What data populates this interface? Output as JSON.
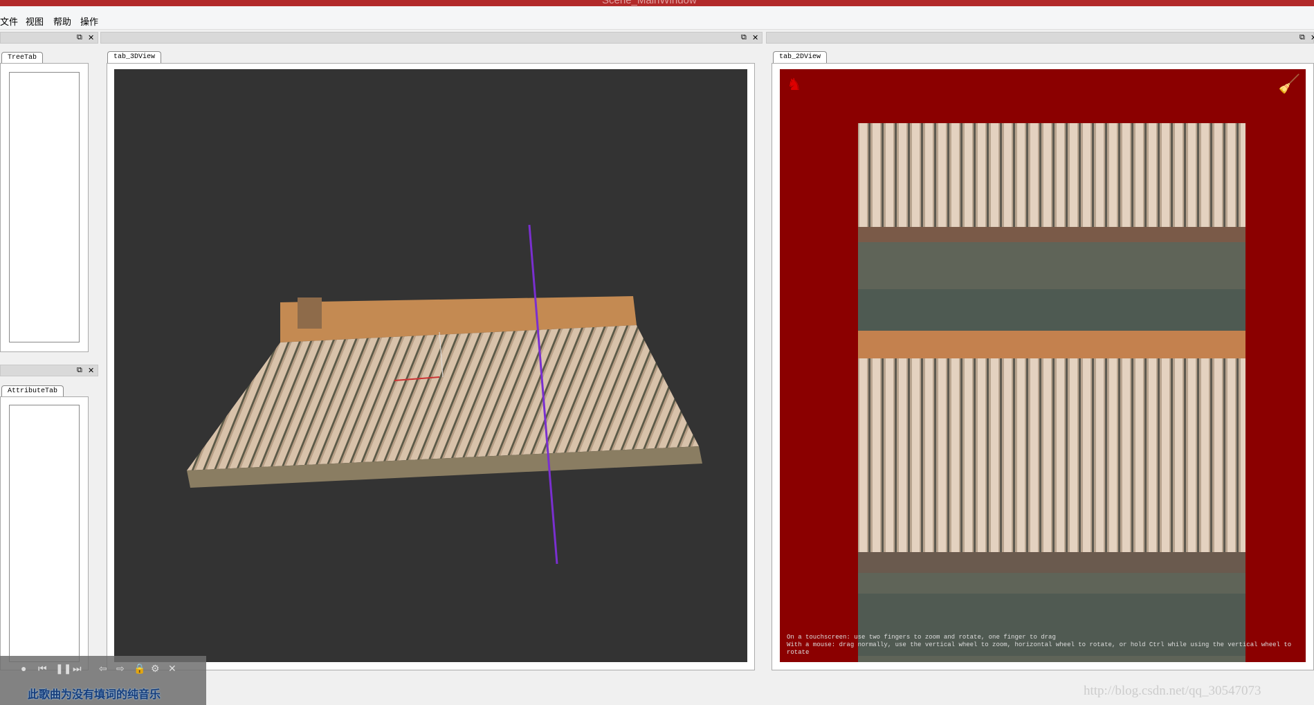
{
  "window": {
    "title": "Scene_MainWindow"
  },
  "menu": [
    "文件",
    "视图",
    "帮助",
    "操作"
  ],
  "docks": {
    "float_icon": "float-icon",
    "close": "✕"
  },
  "tabs": {
    "tree": "TreeTab",
    "attribute": "AttributeTab",
    "view3d": "tab_3DView",
    "view2d": "tab_2DView"
  },
  "view2d": {
    "hint": "On a touchscreen: use two fingers to zoom and rotate, one finger to drag\nWith a mouse: drag normally, use the vertical wheel to zoom, horizontal wheel to rotate, or hold Ctrl while using the vertical wheel to rotate"
  },
  "player": {
    "lyric": "此歌曲为没有填词的纯音乐"
  },
  "watermark": "http://blog.csdn.net/qq_30547073",
  "colors": {
    "title": "#b22a2a",
    "view3d_bg": "#333333",
    "view2d_bg": "#8b0000",
    "axis": "#7a2fd0"
  }
}
